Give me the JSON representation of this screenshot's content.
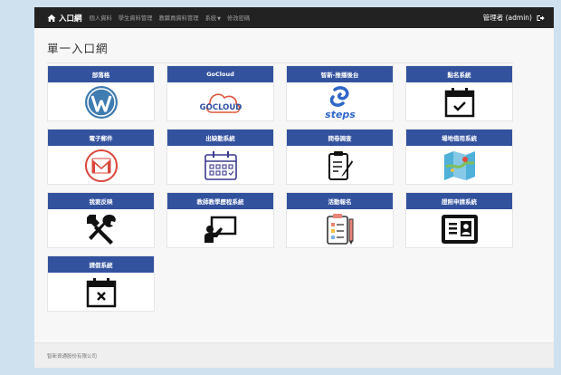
{
  "nav": {
    "brand": "入口網",
    "links": [
      "個人資料",
      "學生資料管理",
      "教職員資料管理",
      "系統",
      "修改密碼"
    ],
    "user": "管理者 (admin)"
  },
  "page_title": "單一入口網",
  "cards": [
    {
      "label": "部落格",
      "icon": "wordpress-icon"
    },
    {
      "label": "GoCloud",
      "icon": "gocloud-logo",
      "logo_text": "GOCLOUD"
    },
    {
      "label": "智新-推播後台",
      "icon": "steps-logo",
      "logo_text": "steps"
    },
    {
      "label": "點名系統",
      "icon": "calendar-check-icon"
    },
    {
      "label": "電子郵件",
      "icon": "gmail-icon"
    },
    {
      "label": "出缺勤系統",
      "icon": "calendar-grid-icon"
    },
    {
      "label": "問卷調查",
      "icon": "clipboard-pen-icon"
    },
    {
      "label": "場地借用系統",
      "icon": "map-icon"
    },
    {
      "label": "我要反映",
      "icon": "tools-icon"
    },
    {
      "label": "教師教學歷程系統",
      "icon": "teacher-board-icon"
    },
    {
      "label": "活動報名",
      "icon": "clipboard-list-icon"
    },
    {
      "label": "證照申請系統",
      "icon": "id-card-icon"
    },
    {
      "label": "請假系統",
      "icon": "calendar-x-icon"
    }
  ],
  "footer": "智新資通股份有限公司"
}
